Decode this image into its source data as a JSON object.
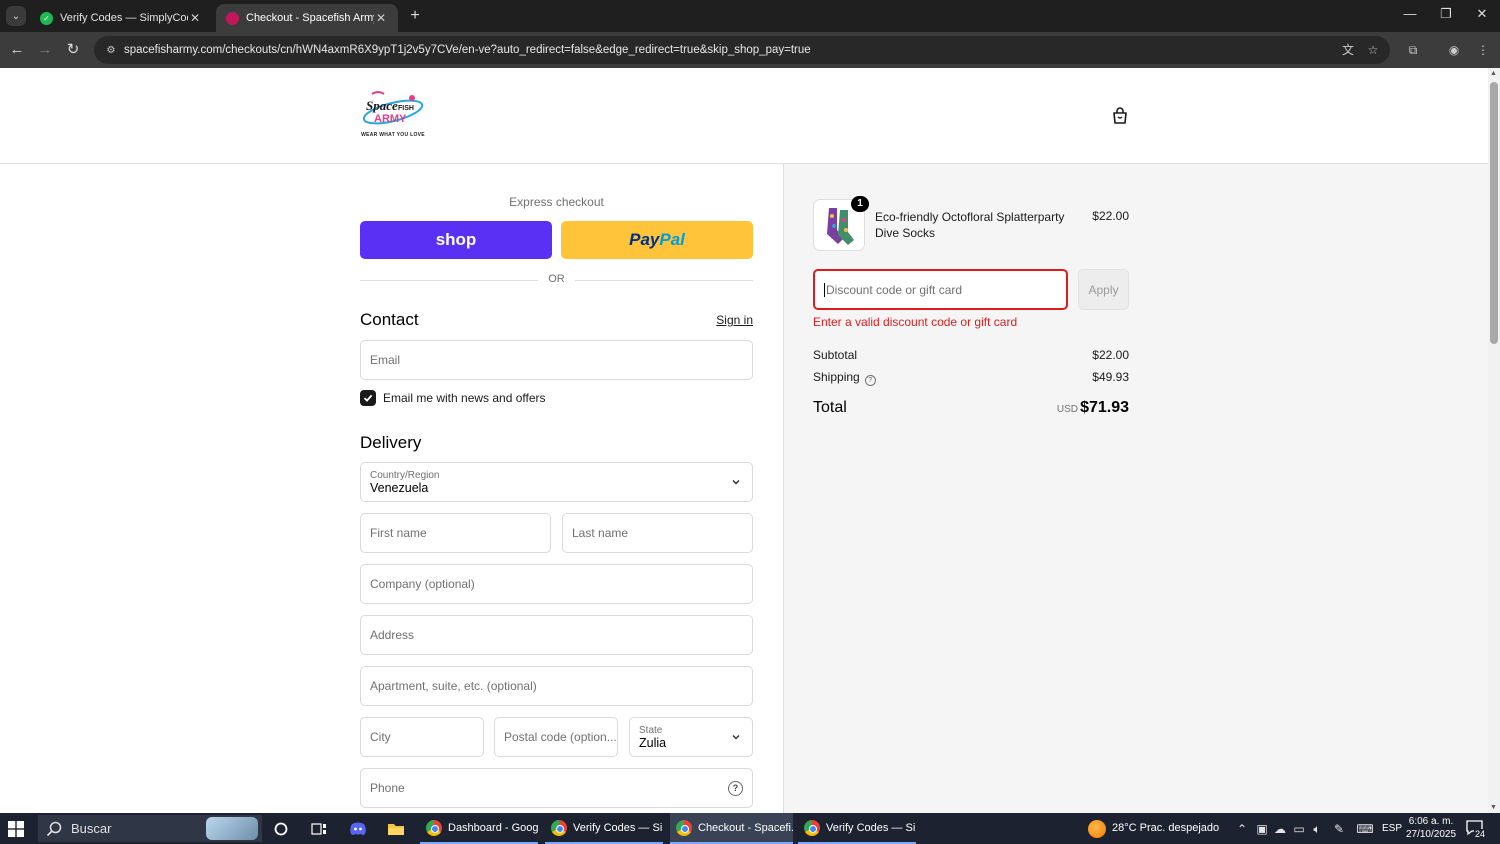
{
  "browser": {
    "tabs": [
      {
        "title": "Verify Codes — SimplyCodes",
        "favicon_color": "#1db954"
      },
      {
        "title": "Checkout - Spacefish Army",
        "favicon_color": "#c2185b"
      }
    ],
    "url": "spacefisharmy.com/checkouts/cn/hWN4axmR6X9ypT1j2v5y7CVe/en-ve?auto_redirect=false&edge_redirect=true&skip_shop_pay=true"
  },
  "header": {
    "logo_tagline": "WEAR WHAT YOU LOVE"
  },
  "express": {
    "title": "Express checkout",
    "shop_label": "shop",
    "paypal_pay": "Pay",
    "paypal_pal": "Pal",
    "or_label": "OR"
  },
  "contact": {
    "title": "Contact",
    "sign_in": "Sign in",
    "email_placeholder": "Email",
    "newsletter_label": "Email me with news and offers",
    "newsletter_checked": true
  },
  "delivery": {
    "title": "Delivery",
    "country_label": "Country/Region",
    "country_value": "Venezuela",
    "first_name": "First name",
    "last_name": "Last name",
    "company": "Company (optional)",
    "address": "Address",
    "apartment": "Apartment, suite, etc. (optional)",
    "city": "City",
    "postal_code": "Postal code (option...",
    "state_label": "State",
    "state_value": "Zulia",
    "phone": "Phone"
  },
  "summary": {
    "product": {
      "name": "Eco-friendly Octofloral Splatterparty Dive Socks",
      "price": "$22.00",
      "quantity": "1"
    },
    "discount_placeholder": "Discount code or gift card",
    "apply_label": "Apply",
    "error": "Enter a valid discount code or gift card",
    "subtotal_label": "Subtotal",
    "subtotal_value": "$22.00",
    "shipping_label": "Shipping",
    "shipping_value": "$49.93",
    "total_label": "Total",
    "total_currency": "USD",
    "total_value": "$71.93"
  },
  "taskbar": {
    "search_label": "Buscar",
    "apps": [
      {
        "title": "Dashboard - Googl..."
      },
      {
        "title": "Verify Codes — Sim..."
      },
      {
        "title": "Checkout - Spacefi..."
      },
      {
        "title": "Verify Codes — Sim..."
      }
    ],
    "weather": "28°C  Prac. despejado",
    "language": "ESP",
    "time": "6:06 a. m.",
    "date": "27/10/2025",
    "notifications": "24"
  },
  "colors": {
    "shop_purple": "#5a31f4",
    "paypal_yellow": "#ffc439",
    "error_red": "#dd1d1d"
  }
}
